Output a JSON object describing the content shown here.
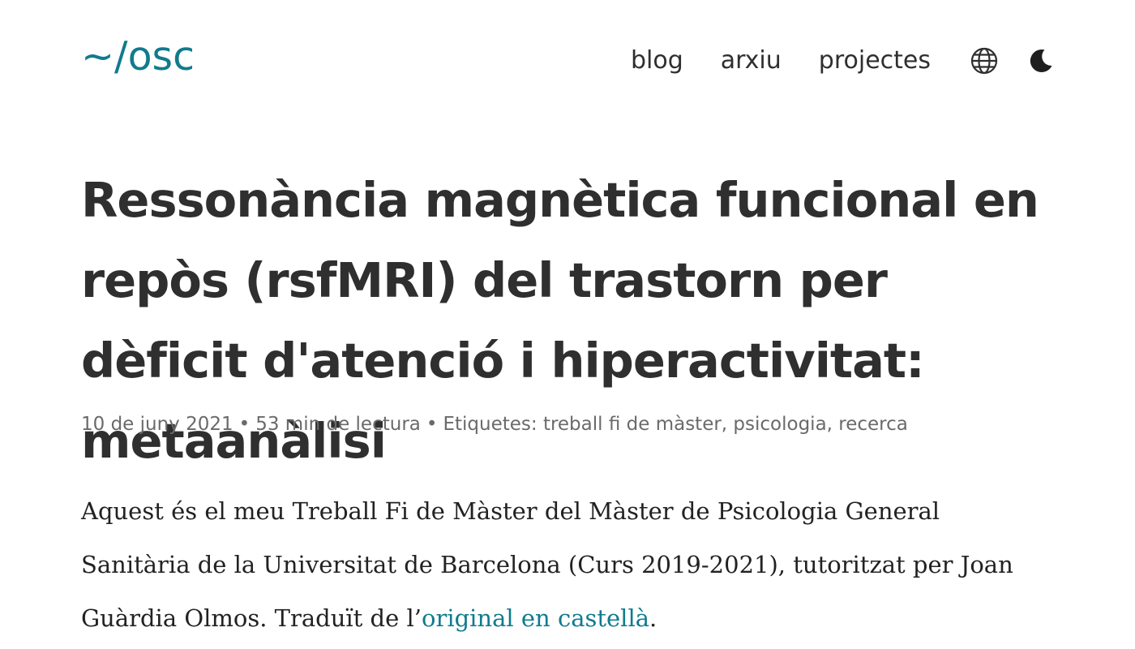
{
  "site": {
    "logo": "~/osc"
  },
  "nav": {
    "items": [
      {
        "label": "blog"
      },
      {
        "label": "arxiu"
      },
      {
        "label": "projectes"
      }
    ],
    "language_icon": "globe-icon",
    "theme_icon": "moon-icon"
  },
  "article": {
    "title": "Ressonància magnètica funcional en repòs (rsfMRI) del trastorn per dèficit d'atenció i hiperactivitat: metaanàlisi",
    "meta": {
      "date": "10 de juny 2021",
      "reading_time": "53 min de lectura",
      "separator": "•",
      "tags_label": "Etiquetes:",
      "tags": "treball fi de màster, psicologia, recerca"
    },
    "intro": {
      "text_before": "Aquest és el meu Treball Fi de Màster del Màster de Psicologia General Sanitària de la Universitat de Barcelona (Curs 2019-2021), tutoritzat per Joan Guàrdia Olmos. Traduït de l’",
      "link_text": "original en castellà",
      "text_after": "."
    }
  },
  "colors": {
    "accent": "#0f7b8e",
    "text": "#2f2f2f",
    "muted": "#6a6a6a"
  }
}
